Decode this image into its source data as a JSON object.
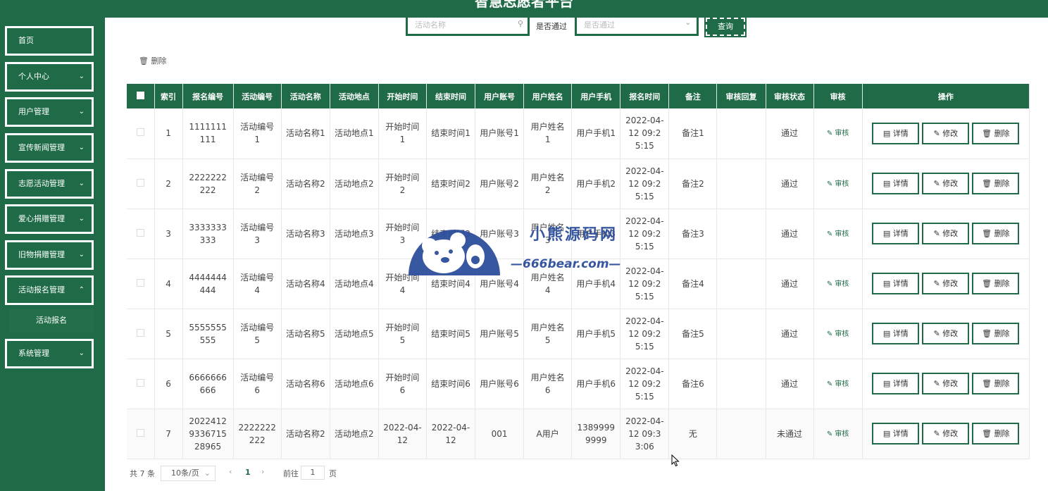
{
  "header": {
    "title": "智慧志愿者平台"
  },
  "sidebar": {
    "items": [
      {
        "label": "首页",
        "chevron": ""
      },
      {
        "label": "个人中心",
        "chevron": "⌄"
      },
      {
        "label": "用户管理",
        "chevron": "⌄"
      },
      {
        "label": "宣传新闻管理",
        "chevron": "⌄"
      },
      {
        "label": "志愿活动管理",
        "chevron": "⌄"
      },
      {
        "label": "爱心捐赠管理",
        "chevron": "⌄"
      },
      {
        "label": "旧物捐赠管理",
        "chevron": "⌄"
      },
      {
        "label": "活动报名管理",
        "chevron": "⌃"
      },
      {
        "label": "系统管理",
        "chevron": "⌄"
      }
    ],
    "submenu": {
      "label": "活动报名"
    }
  },
  "search": {
    "name_placeholder": "活动名称",
    "pass_label": "是否通过",
    "pass_placeholder": "是否通过",
    "query_label": "查询"
  },
  "toolbar": {
    "delete_label": "删除"
  },
  "table": {
    "headers": [
      "",
      "索引",
      "报名编号",
      "活动编号",
      "活动名称",
      "活动地点",
      "开始时间",
      "结束时间",
      "用户账号",
      "用户姓名",
      "用户手机",
      "报名时间",
      "备注",
      "审核回复",
      "审核状态",
      "审核",
      "操作"
    ],
    "rows": [
      {
        "index": "1",
        "reg_no": "1111111111",
        "act_no": "活动编号1",
        "act_name": "活动名称1",
        "location": "活动地点1",
        "start": "开始时间1",
        "end": "结束时间1",
        "account": "用户账号1",
        "name": "用户姓名1",
        "phone": "用户手机1",
        "reg_time": "2022-04-12 09:25:15",
        "remark": "备注1",
        "reply": "",
        "status": "通过"
      },
      {
        "index": "2",
        "reg_no": "2222222222",
        "act_no": "活动编号2",
        "act_name": "活动名称2",
        "location": "活动地点2",
        "start": "开始时间2",
        "end": "结束时间2",
        "account": "用户账号2",
        "name": "用户姓名2",
        "phone": "用户手机2",
        "reg_time": "2022-04-12 09:25:15",
        "remark": "备注2",
        "reply": "",
        "status": "通过"
      },
      {
        "index": "3",
        "reg_no": "3333333333",
        "act_no": "活动编号3",
        "act_name": "活动名称3",
        "location": "活动地点3",
        "start": "开始时间3",
        "end": "结束时间3",
        "account": "用户账号3",
        "name": "用户姓名3",
        "phone": "用户手机3",
        "reg_time": "2022-04-12 09:25:15",
        "remark": "备注3",
        "reply": "",
        "status": "通过"
      },
      {
        "index": "4",
        "reg_no": "4444444444",
        "act_no": "活动编号4",
        "act_name": "活动名称4",
        "location": "活动地点4",
        "start": "开始时间4",
        "end": "结束时间4",
        "account": "用户账号4",
        "name": "用户姓名4",
        "phone": "用户手机4",
        "reg_time": "2022-04-12 09:25:15",
        "remark": "备注4",
        "reply": "",
        "status": "通过"
      },
      {
        "index": "5",
        "reg_no": "5555555555",
        "act_no": "活动编号5",
        "act_name": "活动名称5",
        "location": "活动地点5",
        "start": "开始时间5",
        "end": "结束时间5",
        "account": "用户账号5",
        "name": "用户姓名5",
        "phone": "用户手机5",
        "reg_time": "2022-04-12 09:25:15",
        "remark": "备注5",
        "reply": "",
        "status": "通过"
      },
      {
        "index": "6",
        "reg_no": "6666666666",
        "act_no": "活动编号6",
        "act_name": "活动名称6",
        "location": "活动地点6",
        "start": "开始时间6",
        "end": "结束时间6",
        "account": "用户账号6",
        "name": "用户姓名6",
        "phone": "用户手机6",
        "reg_time": "2022-04-12 09:25:15",
        "remark": "备注6",
        "reply": "",
        "status": "通过"
      },
      {
        "index": "7",
        "reg_no": "2022412933671528965",
        "act_no": "2222222222",
        "act_name": "活动名称2",
        "location": "活动地点2",
        "start": "2022-04-12",
        "end": "2022-04-12",
        "account": "001",
        "name": "A用户",
        "phone": "13899999999",
        "reg_time": "2022-04-12 09:33:06",
        "remark": "无",
        "reply": "",
        "status": "未通过"
      }
    ],
    "audit_label": "审核",
    "detail_label": "详情",
    "edit_label": "修改",
    "delete_label": "删除"
  },
  "pagination": {
    "total": "共 7 条",
    "page_size": "10条/页",
    "current_page": "1",
    "goto_label": "前往",
    "goto_value": "1",
    "page_unit": "页"
  },
  "watermark": {
    "title": "小熊源码网",
    "url": "—666bear.com—"
  },
  "colors": {
    "primary": "#1f6b47",
    "watermark": "#2d4f9c"
  }
}
